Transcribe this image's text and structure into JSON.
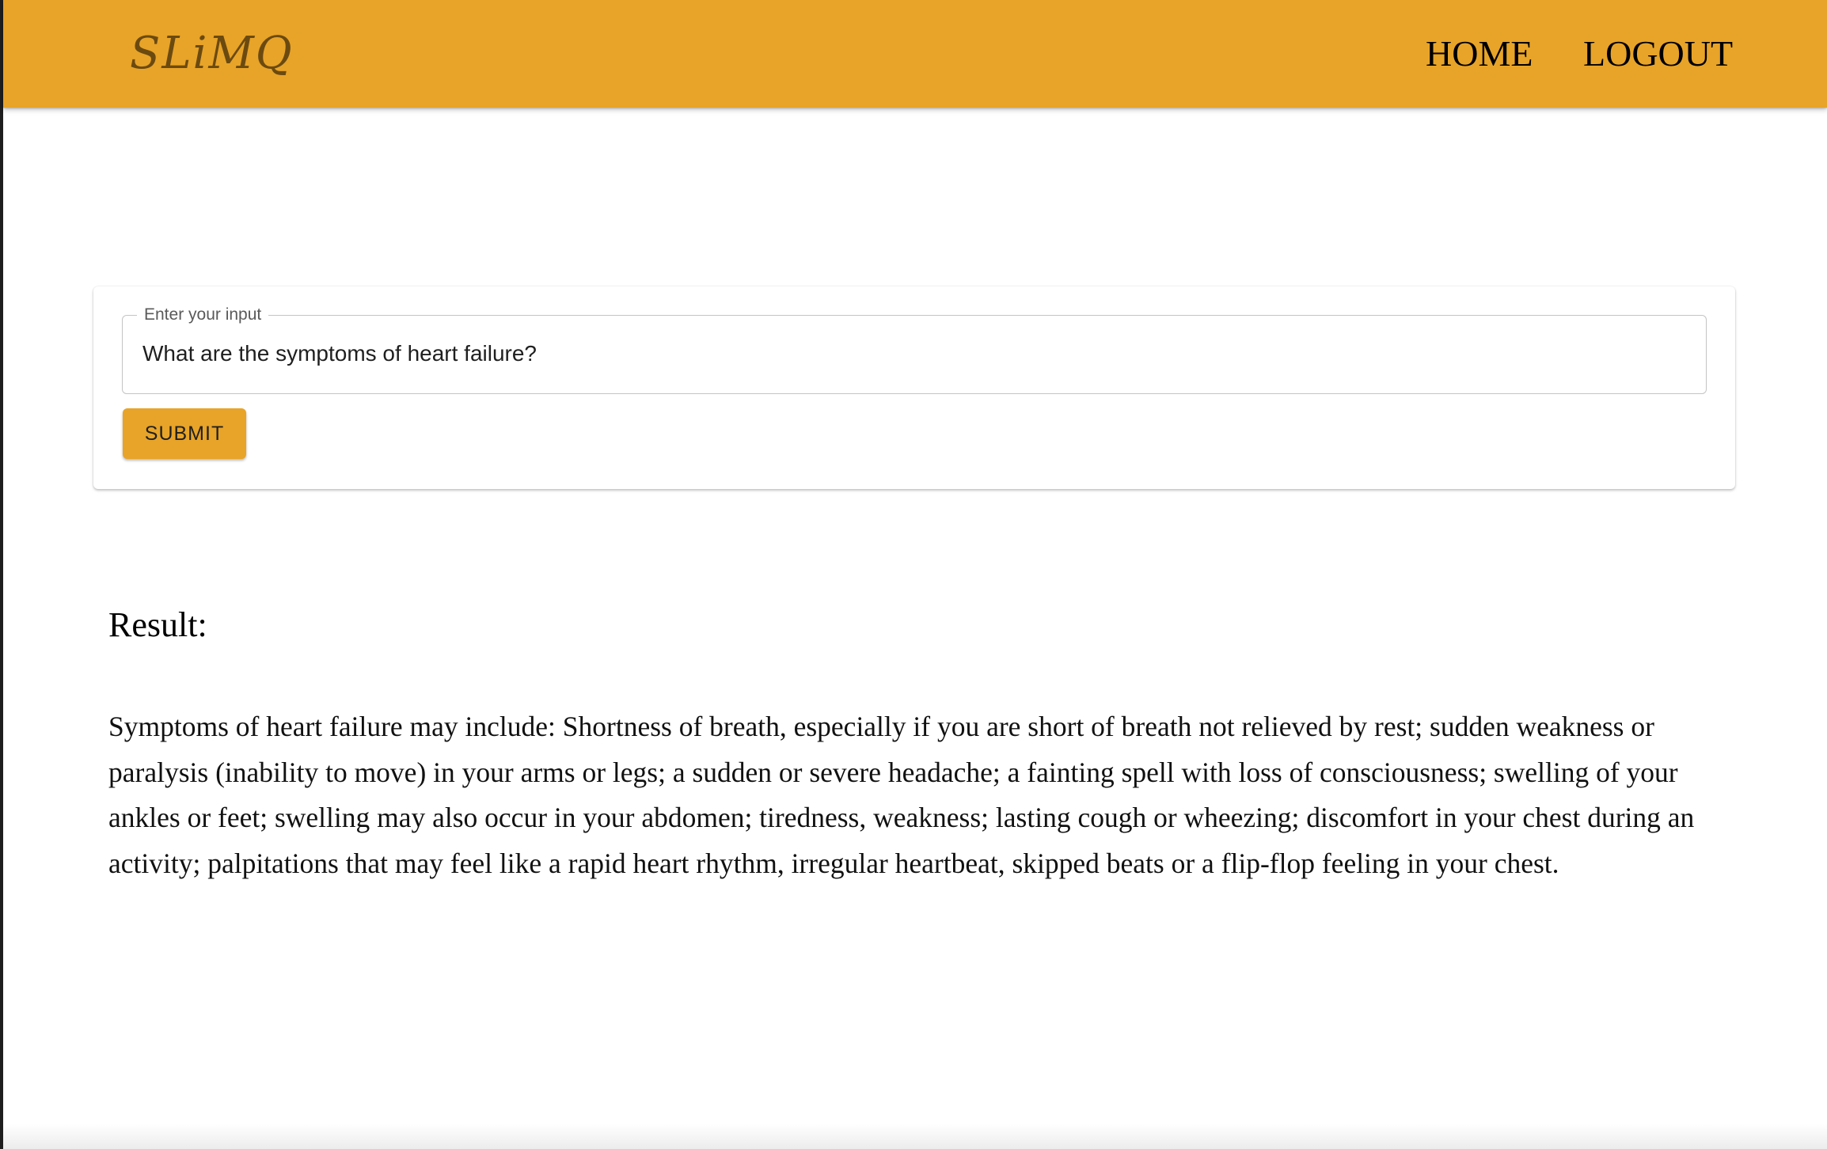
{
  "header": {
    "brand": "SLiMQ",
    "nav": {
      "home": "HOME",
      "logout": "LOGOUT"
    }
  },
  "form": {
    "input_label": "Enter your input",
    "input_value": "What are the symptoms of heart failure?",
    "submit_label": "SUBMIT"
  },
  "result": {
    "heading": "Result:",
    "text": "Symptoms of heart failure may include: Shortness of breath, especially if you are short of breath not relieved by rest; sudden weakness or paralysis (inability to move) in your arms or legs; a sudden or severe headache; a fainting spell with loss of consciousness; swelling of your ankles or feet; swelling may also occur in your abdomen; tiredness, weakness; lasting cough or wheezing; discomfort in your chest during an activity; palpitations that may feel like a rapid heart rhythm, irregular heartbeat, skipped beats or a flip-flop feeling in your chest."
  },
  "colors": {
    "accent": "#e8a428",
    "brand_text": "#6b4a10"
  }
}
